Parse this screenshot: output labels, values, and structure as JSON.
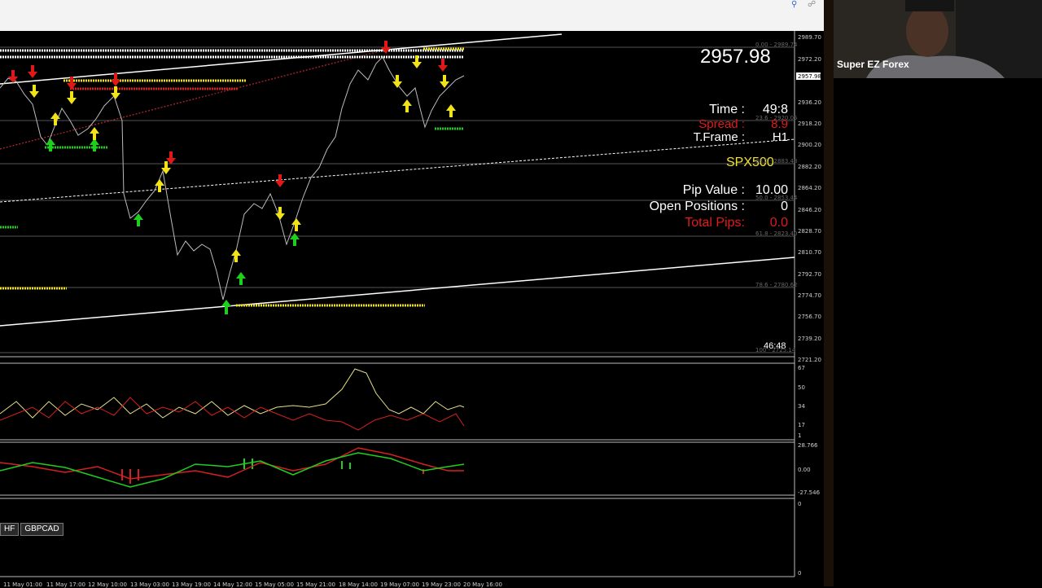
{
  "toolbar": {
    "zoom_icon": "magnifier-icon",
    "link_icon": "link-icon"
  },
  "chart": {
    "last_price": "2957.98",
    "info": {
      "time_label": "Time :",
      "time_value": "49:8",
      "spread_label": "Spread :",
      "spread_value": "8.9",
      "tframe_label": "T.Frame :",
      "tframe_value": "H1",
      "symbol": "SPX500",
      "pip_label": "Pip Value :",
      "pip_value": "10.00",
      "open_label": "Open Positions :",
      "open_value": "0",
      "pips_label": "Total Pips:",
      "pips_value": "0.0"
    },
    "price_axis": [
      "2989.70",
      "2972.20",
      "2957.98",
      "2936.20",
      "2918.20",
      "2900.20",
      "2882.20",
      "2864.20",
      "2846.20",
      "2828.70",
      "2810.70",
      "2792.70",
      "2774.70",
      "2756.70",
      "2739.20",
      "2721.20"
    ],
    "fib_labels": [
      "0.00 - 2989.74",
      "23.6 - 2920.05",
      "38.2 - 2883.48",
      "50.0 - 2853.44",
      "61.8 - 2823.40",
      "78.6 - 2780.62",
      "100 - 2725.14"
    ],
    "osc1_axis": [
      "67",
      "50",
      "34",
      "17",
      "1"
    ],
    "osc2_axis": [
      "28.766",
      "0.00",
      "-27.546"
    ],
    "vol_axis": [
      "0",
      "0"
    ],
    "countdown": "46:48",
    "time_axis": [
      "11 May 01:00",
      "11 May 17:00",
      "12 May 10:00",
      "13 May 03:00",
      "13 May 19:00",
      "14 May 12:00",
      "15 May 05:00",
      "15 May 21:00",
      "18 May 14:00",
      "19 May 07:00",
      "19 May 23:00",
      "20 May 16:00"
    ]
  },
  "tabs": [
    "HF",
    "GBPCAD"
  ],
  "colors": {
    "up_arrow": "#1ecf1e",
    "down_arrow": "#e01818",
    "signal": "#f2e21a",
    "line": "#ffffff"
  },
  "webcam": {
    "name": "Super EZ Forex"
  }
}
